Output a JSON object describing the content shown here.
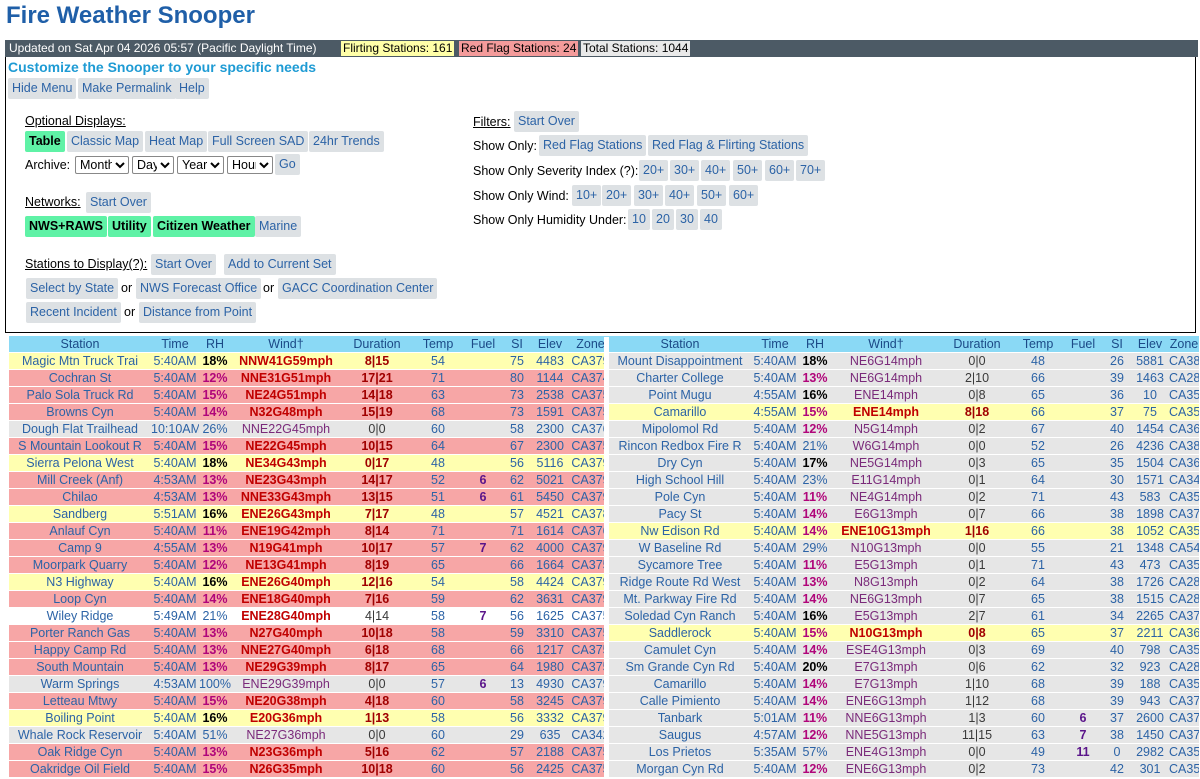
{
  "page": {
    "title": "Fire Weather Snooper"
  },
  "status": {
    "updated": "Updated on Sat Apr 04 2026 05:57 (Pacific Daylight Time)",
    "flirting": "Flirting Stations: 161",
    "redflag": "Red Flag Stations: 24",
    "total": "Total Stations: 1044"
  },
  "panel": {
    "title": "Customize the Snooper to your specific needs",
    "top_buttons": [
      "Hide Menu",
      "Make Permalink",
      "Help"
    ],
    "optional_displays_label": "Optional Displays:",
    "displays": [
      "Table",
      "Classic Map",
      "Heat Map",
      "Full Screen SAD",
      "24hr Trends"
    ],
    "archive_label": "Archive:",
    "archive_selects": [
      "Month",
      "Day",
      "Year",
      "Hour"
    ],
    "go_label": "Go",
    "networks_label": "Networks:",
    "start_over": "Start Over",
    "networks": [
      "NWS+RAWS",
      "Utility",
      "Citizen Weather",
      "Marine"
    ],
    "stations_label": "Stations to Display(?):",
    "add_current": "Add to Current Set",
    "select_state": "Select by State",
    "or": "or",
    "nws_office": "NWS Forecast Office",
    "gacc": "GACC Coordination Center",
    "recent_incident": "Recent Incident",
    "distance": "Distance from Point",
    "filters_label": "Filters:",
    "show_only": "Show Only:",
    "red_flag": "Red Flag Stations",
    "red_flirting": "Red Flag & Flirting Stations",
    "severity_label": "Show Only Severity Index (?):",
    "severity": [
      "20+",
      "30+",
      "40+",
      "50+",
      "60+",
      "70+"
    ],
    "wind_label": "Show Only Wind:",
    "wind": [
      "10+",
      "20+",
      "30+",
      "40+",
      "50+",
      "60+"
    ],
    "humidity_label": "Show Only Humidity Under:",
    "humidity": [
      "10",
      "20",
      "30",
      "40"
    ]
  },
  "table": {
    "headers": [
      "Station",
      "Time",
      "RH",
      "Wind†",
      "Duration",
      "Temp",
      "Fuel",
      "SI",
      "Elev",
      "Zone"
    ],
    "left": [
      {
        "s": "Magic Mtn Truck Trai",
        "t": "5:40AM",
        "rh": "18%",
        "w": "NNW41G59mph",
        "d": "8|15",
        "tp": "54",
        "f": "",
        "si": "75",
        "e": "4483",
        "z": "CA379",
        "c": "yel"
      },
      {
        "s": "Cochran St",
        "t": "5:40AM",
        "rh": "12%",
        "w": "NNE31G51mph",
        "d": "17|21",
        "tp": "71",
        "f": "",
        "si": "80",
        "e": "1144",
        "z": "CA374",
        "c": "red"
      },
      {
        "s": "Palo Sola Truck Rd",
        "t": "5:40AM",
        "rh": "15%",
        "w": "NE24G51mph",
        "d": "14|18",
        "tp": "63",
        "f": "",
        "si": "73",
        "e": "2538",
        "z": "CA375",
        "c": "red"
      },
      {
        "s": "Browns Cyn",
        "t": "5:40AM",
        "rh": "14%",
        "w": "N32G48mph",
        "d": "15|19",
        "tp": "68",
        "f": "",
        "si": "73",
        "e": "1591",
        "z": "CA375",
        "c": "red"
      },
      {
        "s": "Dough Flat Trailhead",
        "t": "10:10AM",
        "rh": "26%",
        "w": "NNE22G45mph",
        "d": "0|0",
        "tp": "60",
        "f": "",
        "si": "58",
        "e": "2300",
        "z": "CA376",
        "c": "gry"
      },
      {
        "s": "S Mountain Lookout R",
        "t": "5:40AM",
        "rh": "15%",
        "w": "NE22G45mph",
        "d": "10|15",
        "tp": "64",
        "f": "",
        "si": "67",
        "e": "2300",
        "z": "CA375",
        "c": "red"
      },
      {
        "s": "Sierra Pelona West",
        "t": "5:40AM",
        "rh": "18%",
        "w": "NE34G43mph",
        "d": "0|17",
        "tp": "48",
        "f": "",
        "si": "56",
        "e": "5116",
        "z": "CA379",
        "c": "yel"
      },
      {
        "s": "Mill Creek (Anf)",
        "t": "4:53AM",
        "rh": "13%",
        "w": "NE23G43mph",
        "d": "14|17",
        "tp": "52",
        "f": "6",
        "si": "62",
        "e": "5021",
        "z": "CA379",
        "c": "red"
      },
      {
        "s": "Chilao",
        "t": "4:53AM",
        "rh": "13%",
        "w": "NNE33G43mph",
        "d": "13|15",
        "tp": "51",
        "f": "6",
        "si": "61",
        "e": "5450",
        "z": "CA379",
        "c": "red"
      },
      {
        "s": "Sandberg",
        "t": "5:51AM",
        "rh": "16%",
        "w": "ENE26G43mph",
        "d": "7|17",
        "tp": "48",
        "f": "",
        "si": "57",
        "e": "4521",
        "z": "CA378",
        "c": "yel"
      },
      {
        "s": "Anlauf Cyn",
        "t": "5:40AM",
        "rh": "11%",
        "w": "ENE19G42mph",
        "d": "8|14",
        "tp": "71",
        "f": "",
        "si": "71",
        "e": "1614",
        "z": "CA376",
        "c": "red"
      },
      {
        "s": "Camp 9",
        "t": "4:55AM",
        "rh": "13%",
        "w": "N19G41mph",
        "d": "10|17",
        "tp": "57",
        "f": "7",
        "si": "62",
        "e": "4000",
        "z": "CA379",
        "c": "red"
      },
      {
        "s": "Moorpark Quarry",
        "t": "5:40AM",
        "rh": "12%",
        "w": "NE13G41mph",
        "d": "8|19",
        "tp": "65",
        "f": "",
        "si": "66",
        "e": "1664",
        "z": "CA375",
        "c": "red"
      },
      {
        "s": "N3 Highway",
        "t": "5:40AM",
        "rh": "16%",
        "w": "ENE26G40mph",
        "d": "12|16",
        "tp": "54",
        "f": "",
        "si": "58",
        "e": "4424",
        "z": "CA379",
        "c": "yel"
      },
      {
        "s": "Loop Cyn",
        "t": "5:40AM",
        "rh": "14%",
        "w": "ENE18G40mph",
        "d": "7|16",
        "tp": "59",
        "f": "",
        "si": "62",
        "e": "3631",
        "z": "CA379",
        "c": "red"
      },
      {
        "s": "Wiley Ridge",
        "t": "5:49AM",
        "rh": "21%",
        "w": "ENE28G40mph",
        "d": "4|14",
        "tp": "58",
        "f": "7",
        "si": "56",
        "e": "1625",
        "z": "CA375",
        "c": "wht"
      },
      {
        "s": "Porter Ranch Gas",
        "t": "5:40AM",
        "rh": "13%",
        "w": "N27G40mph",
        "d": "10|18",
        "tp": "58",
        "f": "",
        "si": "59",
        "e": "3310",
        "z": "CA375",
        "c": "red"
      },
      {
        "s": "Happy Camp Rd",
        "t": "5:40AM",
        "rh": "13%",
        "w": "NNE27G40mph",
        "d": "6|18",
        "tp": "68",
        "f": "",
        "si": "66",
        "e": "1217",
        "z": "CA375",
        "c": "red"
      },
      {
        "s": "South Mountain",
        "t": "5:40AM",
        "rh": "13%",
        "w": "NE29G39mph",
        "d": "8|17",
        "tp": "65",
        "f": "",
        "si": "64",
        "e": "1980",
        "z": "CA375",
        "c": "red"
      },
      {
        "s": "Warm Springs",
        "t": "4:53AM",
        "rh": "100%",
        "w": "ENE29G39mph",
        "d": "0|0",
        "tp": "57",
        "f": "6",
        "si": "13",
        "e": "4930",
        "z": "CA379",
        "c": "gry"
      },
      {
        "s": "Letteau Mtwy",
        "t": "5:40AM",
        "rh": "15%",
        "w": "NE20G38mph",
        "d": "4|18",
        "tp": "60",
        "f": "",
        "si": "58",
        "e": "3245",
        "z": "CA379",
        "c": "red"
      },
      {
        "s": "Boiling Point",
        "t": "5:40AM",
        "rh": "16%",
        "w": "E20G36mph",
        "d": "1|13",
        "tp": "58",
        "f": "",
        "si": "56",
        "e": "3332",
        "z": "CA379",
        "c": "yel"
      },
      {
        "s": "Whale Rock Reservoir",
        "t": "5:40AM",
        "rh": "51%",
        "w": "NE27G36mph",
        "d": "0|0",
        "tp": "60",
        "f": "",
        "si": "29",
        "e": "635",
        "z": "CA342",
        "c": "gry"
      },
      {
        "s": "Oak Ridge Cyn",
        "t": "5:40AM",
        "rh": "13%",
        "w": "N23G36mph",
        "d": "5|16",
        "tp": "62",
        "f": "",
        "si": "57",
        "e": "2188",
        "z": "CA375",
        "c": "red"
      },
      {
        "s": "Oakridge Oil Field",
        "t": "5:40AM",
        "rh": "15%",
        "w": "N26G35mph",
        "d": "10|18",
        "tp": "60",
        "f": "",
        "si": "56",
        "e": "2425",
        "z": "CA375",
        "c": "red"
      }
    ],
    "right": [
      {
        "s": "Mount Disappointment",
        "t": "5:40AM",
        "rh": "18%",
        "w": "NE6G14mph",
        "d": "0|0",
        "tp": "48",
        "f": "",
        "si": "26",
        "e": "5881",
        "z": "CA380",
        "c": "gry"
      },
      {
        "s": "Charter College",
        "t": "5:40AM",
        "rh": "13%",
        "w": "NE6G14mph",
        "d": "2|10",
        "tp": "66",
        "f": "",
        "si": "39",
        "e": "1463",
        "z": "CA288",
        "c": "gry"
      },
      {
        "s": "Point Mugu",
        "t": "4:55AM",
        "rh": "16%",
        "w": "ENE14mph",
        "d": "0|8",
        "tp": "65",
        "f": "",
        "si": "36",
        "e": "10",
        "z": "CA354",
        "c": "gry"
      },
      {
        "s": "Camarillo",
        "t": "4:55AM",
        "rh": "15%",
        "w": "ENE14mph",
        "d": "8|18",
        "tp": "66",
        "f": "",
        "si": "37",
        "e": "75",
        "z": "CA355",
        "c": "yel"
      },
      {
        "s": "Mipolomol Rd",
        "t": "5:40AM",
        "rh": "12%",
        "w": "N5G14mph",
        "d": "0|2",
        "tp": "67",
        "f": "",
        "si": "40",
        "e": "1454",
        "z": "CA369",
        "c": "gry"
      },
      {
        "s": "Rincon Redbox Fire R",
        "t": "5:40AM",
        "rh": "21%",
        "w": "W6G14mph",
        "d": "0|0",
        "tp": "52",
        "f": "",
        "si": "26",
        "e": "4236",
        "z": "CA380",
        "c": "gry"
      },
      {
        "s": "Dry Cyn",
        "t": "5:40AM",
        "rh": "17%",
        "w": "NE5G14mph",
        "d": "0|3",
        "tp": "65",
        "f": "",
        "si": "35",
        "e": "1504",
        "z": "CA369",
        "c": "gry"
      },
      {
        "s": "High School Hill",
        "t": "5:40AM",
        "rh": "23%",
        "w": "E11G14mph",
        "d": "0|1",
        "tp": "64",
        "f": "",
        "si": "30",
        "e": "1571",
        "z": "CA342",
        "c": "gry"
      },
      {
        "s": "Pole Cyn",
        "t": "5:40AM",
        "rh": "11%",
        "w": "NE4G14mph",
        "d": "0|2",
        "tp": "71",
        "f": "",
        "si": "43",
        "e": "583",
        "z": "CA358",
        "c": "gry"
      },
      {
        "s": "Pacy St",
        "t": "5:40AM",
        "rh": "14%",
        "w": "E6G13mph",
        "d": "0|7",
        "tp": "66",
        "f": "",
        "si": "38",
        "e": "1898",
        "z": "CA379",
        "c": "gry"
      },
      {
        "s": "Nw Edison Rd",
        "t": "5:40AM",
        "rh": "14%",
        "w": "ENE10G13mph",
        "d": "1|16",
        "tp": "66",
        "f": "",
        "si": "38",
        "e": "1052",
        "z": "CA355",
        "c": "yel"
      },
      {
        "s": "W Baseline Rd",
        "t": "5:40AM",
        "rh": "29%",
        "w": "N10G13mph",
        "d": "0|0",
        "tp": "55",
        "f": "",
        "si": "21",
        "e": "1348",
        "z": "CA548",
        "c": "gry"
      },
      {
        "s": "Sycamore Tree",
        "t": "5:40AM",
        "rh": "11%",
        "w": "E5G13mph",
        "d": "0|1",
        "tp": "71",
        "f": "",
        "si": "43",
        "e": "473",
        "z": "CA358",
        "c": "gry"
      },
      {
        "s": "Ridge Route Rd West",
        "t": "5:40AM",
        "rh": "13%",
        "w": "N8G13mph",
        "d": "0|2",
        "tp": "64",
        "f": "",
        "si": "38",
        "e": "1726",
        "z": "CA288",
        "c": "gry"
      },
      {
        "s": "Mt. Parkway Fire Rd",
        "t": "5:40AM",
        "rh": "14%",
        "w": "NE6G13mph",
        "d": "0|7",
        "tp": "65",
        "f": "",
        "si": "38",
        "e": "1515",
        "z": "CA288",
        "c": "gry"
      },
      {
        "s": "Soledad Cyn Ranch",
        "t": "5:40AM",
        "rh": "16%",
        "w": "E5G13mph",
        "d": "2|7",
        "tp": "61",
        "f": "",
        "si": "34",
        "e": "2265",
        "z": "CA379",
        "c": "gry"
      },
      {
        "s": "Saddlerock",
        "t": "5:40AM",
        "rh": "15%",
        "w": "N10G13mph",
        "d": "0|8",
        "tp": "65",
        "f": "",
        "si": "37",
        "e": "2211",
        "z": "CA369",
        "c": "yel"
      },
      {
        "s": "Camulet Cyn",
        "t": "5:40AM",
        "rh": "14%",
        "w": "ESE4G13mph",
        "d": "0|3",
        "tp": "69",
        "f": "",
        "si": "40",
        "e": "798",
        "z": "CA358",
        "c": "gry"
      },
      {
        "s": "Sm Grande Cyn Rd",
        "t": "5:40AM",
        "rh": "20%",
        "w": "E7G13mph",
        "d": "0|6",
        "tp": "62",
        "f": "",
        "si": "32",
        "e": "923",
        "z": "CA288",
        "c": "gry"
      },
      {
        "s": "Camarillo",
        "t": "5:40AM",
        "rh": "14%",
        "w": "E7G13mph",
        "d": "1|10",
        "tp": "68",
        "f": "",
        "si": "39",
        "e": "188",
        "z": "CA355",
        "c": "gry"
      },
      {
        "s": "Calle Pimiento",
        "t": "5:40AM",
        "rh": "14%",
        "w": "ENE6G13mph",
        "d": "1|12",
        "tp": "68",
        "f": "",
        "si": "39",
        "e": "943",
        "z": "CA374",
        "c": "gry"
      },
      {
        "s": "Tanbark",
        "t": "5:01AM",
        "rh": "11%",
        "w": "NNE6G13mph",
        "d": "1|3",
        "tp": "60",
        "f": "6",
        "si": "37",
        "e": "2600",
        "z": "CA379",
        "c": "gry"
      },
      {
        "s": "Saugus",
        "t": "4:57AM",
        "rh": "12%",
        "w": "NNE5G13mph",
        "d": "11|15",
        "tp": "63",
        "f": "7",
        "si": "38",
        "e": "1450",
        "z": "CA379",
        "c": "gry"
      },
      {
        "s": "Los Prietos",
        "t": "5:35AM",
        "rh": "57%",
        "w": "ENE4G13mph",
        "d": "0|0",
        "tp": "49",
        "f": "11",
        "si": "0",
        "e": "2982",
        "z": "CA353",
        "c": "gry"
      },
      {
        "s": "Morgan Cyn Rd",
        "t": "5:40AM",
        "rh": "12%",
        "w": "ENE6G13mph",
        "d": "0|2",
        "tp": "73",
        "f": "",
        "si": "42",
        "e": "301",
        "z": "CA358",
        "c": "gry"
      }
    ]
  }
}
